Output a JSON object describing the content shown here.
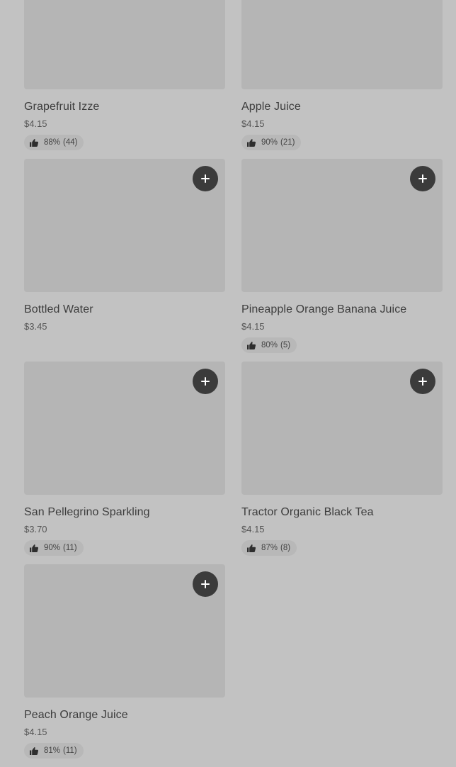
{
  "products": [
    {
      "name": "Grapefruit Izze",
      "price": "$4.15",
      "rating_percent": "88%",
      "rating_count": "(44)",
      "show_add": false,
      "show_rating": true
    },
    {
      "name": "Apple Juice",
      "price": "$4.15",
      "rating_percent": "90%",
      "rating_count": "(21)",
      "show_add": false,
      "show_rating": true
    },
    {
      "name": "Bottled Water",
      "price": "$3.45",
      "rating_percent": "",
      "rating_count": "",
      "show_add": true,
      "show_rating": false
    },
    {
      "name": "Pineapple Orange Banana Juice",
      "price": "$4.15",
      "rating_percent": "80%",
      "rating_count": "(5)",
      "show_add": true,
      "show_rating": true
    },
    {
      "name": "San Pellegrino Sparkling",
      "price": "$3.70",
      "rating_percent": "90%",
      "rating_count": "(11)",
      "show_add": true,
      "show_rating": true
    },
    {
      "name": "Tractor Organic Black Tea",
      "price": "$4.15",
      "rating_percent": "87%",
      "rating_count": "(8)",
      "show_add": true,
      "show_rating": true
    },
    {
      "name": "Peach Orange Juice",
      "price": "$4.15",
      "rating_percent": "81%",
      "rating_count": "(11)",
      "show_add": true,
      "show_rating": true
    }
  ],
  "icons": {
    "add": "plus-icon",
    "rating": "thumbs-up-icon"
  },
  "colors": {
    "background": "#c2c2c2",
    "image_placeholder": "#b5b5b5",
    "add_button": "#3b3b3b",
    "rating_pill": "#b8b8b8"
  }
}
